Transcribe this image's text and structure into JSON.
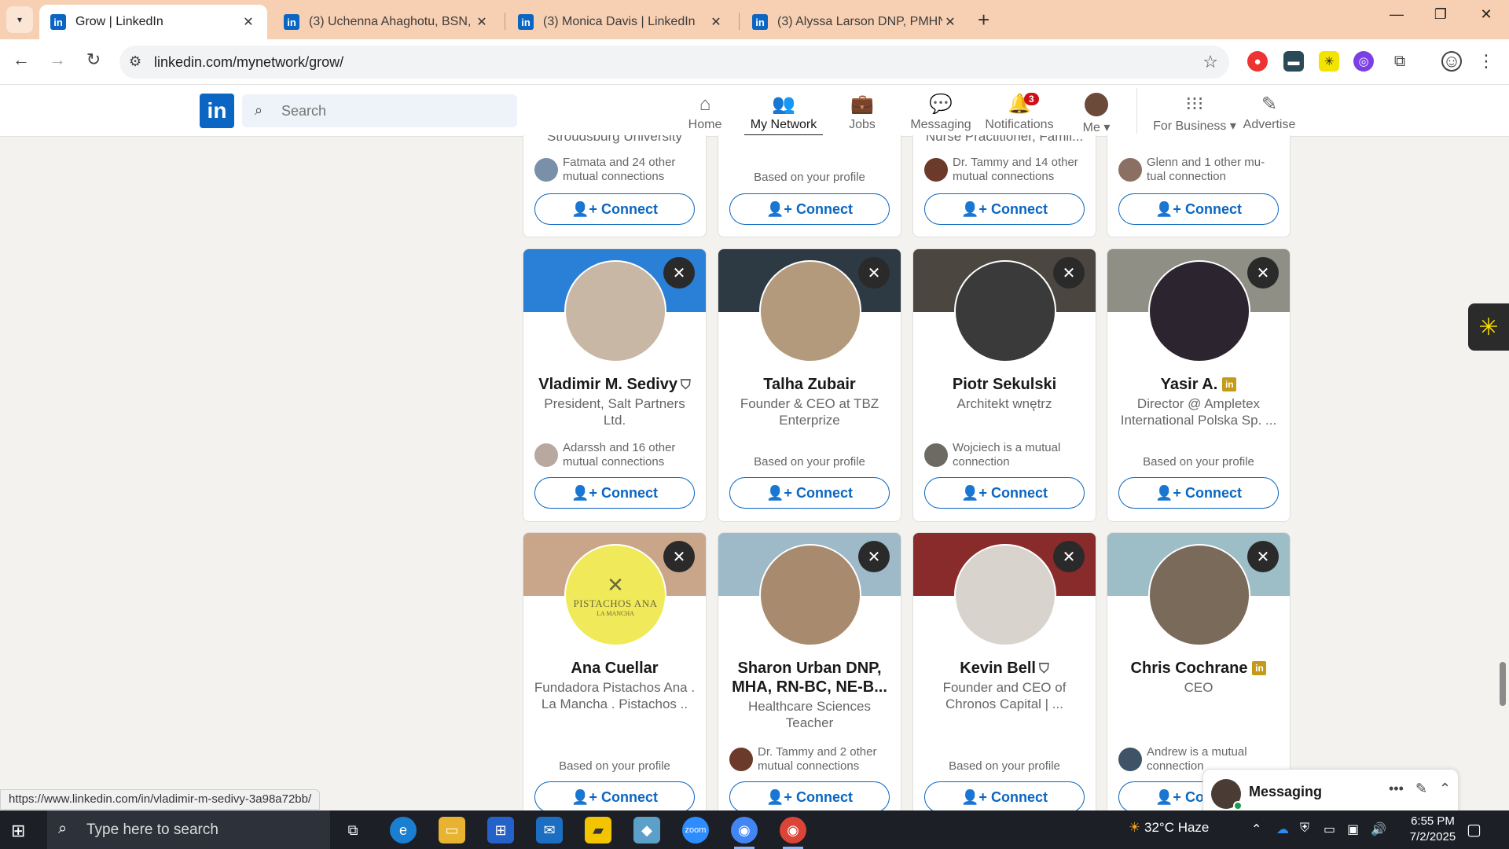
{
  "browser": {
    "tabs": [
      {
        "title": "Grow | LinkedIn",
        "active": true
      },
      {
        "title": "(3) Uchenna Ahaghotu, BSN, RN",
        "active": false
      },
      {
        "title": "(3) Monica Davis | LinkedIn",
        "active": false
      },
      {
        "title": "(3) Alyssa Larson DNP, PMHNP",
        "active": false
      }
    ],
    "url": "linkedin.com/mynetwork/grow/",
    "status_url": "https://www.linkedin.com/in/vladimir-m-sedivy-3a98a72bb/"
  },
  "linkedin": {
    "search_placeholder": "Search",
    "nav": [
      {
        "label": "Home",
        "icon": "home-icon"
      },
      {
        "label": "My Network",
        "icon": "my-network-icon",
        "active": true
      },
      {
        "label": "Jobs",
        "icon": "briefcase-icon"
      },
      {
        "label": "Messaging",
        "icon": "messaging-icon"
      },
      {
        "label": "Notifications",
        "icon": "bell-icon",
        "badge": "3"
      },
      {
        "label": "Me",
        "icon": "avatar"
      },
      {
        "label": "For Business",
        "icon": "grid-icon"
      },
      {
        "label": "Advertise",
        "icon": "advertise-icon"
      }
    ]
  },
  "top_row": [
    {
      "cut_text": "Stroudsburg University",
      "mutual": "Fatmata and 24 other mutual connections",
      "connect": "Connect"
    },
    {
      "cut_text": "",
      "based": "Based on your profile",
      "connect": "Connect"
    },
    {
      "cut_text": "Nurse Practitioner, Famil...",
      "mutual": "Dr. Tammy and 14 other mutual connections",
      "connect": "Connect"
    },
    {
      "cut_text": "",
      "mutual": "Glenn and 1 other mu-tual connection",
      "connect": "Connect"
    }
  ],
  "row2": [
    {
      "name": "Vladimir M. Sedivy",
      "badge": "verified",
      "headline": "President, Salt Partners Ltd.",
      "mutual": "Adarssh and 16 other mutual connections",
      "connect": "Connect",
      "banner_color": "#2a7fd6",
      "photo_color": "#c9b7a5"
    },
    {
      "name": "Talha Zubair",
      "badge": "",
      "headline": "Founder & CEO at TBZ Enterprize",
      "based": "Based on your profile",
      "connect": "Connect",
      "banner_color": "#2d3a44",
      "photo_color": "#b49a7c"
    },
    {
      "name": "Piotr Sekulski",
      "badge": "",
      "headline": "Architekt wnętrz",
      "mutual": "Wojciech is a mutual connection",
      "connect": "Connect",
      "banner_color": "#4b4640",
      "photo_color": "#3a3a3a"
    },
    {
      "name": "Yasir A.",
      "badge": "premium",
      "headline": "Director @ Ampletex International Polska Sp. ...",
      "based": "Based on your profile",
      "connect": "Connect",
      "banner_color": "#8f8f86",
      "photo_color": "#2c2530"
    }
  ],
  "row3": [
    {
      "name": "Ana Cuellar",
      "badge": "",
      "headline": "Fundadora  Pistachos Ana . La Mancha . Pistachos ..",
      "based": "Based on your profile",
      "connect": "Connect",
      "banner_color": "#c9a58a",
      "photo_color": "#f0ea5a",
      "photo_text": "PISTACHOS ANA",
      "photo_subtext": "LA MANCHA"
    },
    {
      "name": "Sharon Urban DNP, MHA, RN-BC, NE-B...",
      "badge": "",
      "headline": "Healthcare Sciences Teacher",
      "mutual": "Dr. Tammy and 2 other mutual connections",
      "connect": "Connect",
      "banner_color": "#9eb9c8",
      "photo_color": "#a88a6e"
    },
    {
      "name": "Kevin Bell",
      "badge": "verified",
      "headline": "Founder and CEO of Chronos Capital | ...",
      "based": "Based on your profile",
      "connect": "Connect",
      "banner_color": "#8a2b2b",
      "photo_color": "#d9d3cd"
    },
    {
      "name": "Chris Cochrane",
      "badge": "premium",
      "headline": "CEO",
      "mutual": "Andrew is a mutual connection",
      "connect": "Connect",
      "banner_color": "#9dbdc7",
      "photo_color": "#7a6a5a"
    }
  ],
  "messaging": {
    "title": "Messaging"
  },
  "taskbar": {
    "search_placeholder": "Type here to search",
    "weather": "32°C  Haze",
    "time": "6:55 PM",
    "date": "7/2/2025"
  }
}
